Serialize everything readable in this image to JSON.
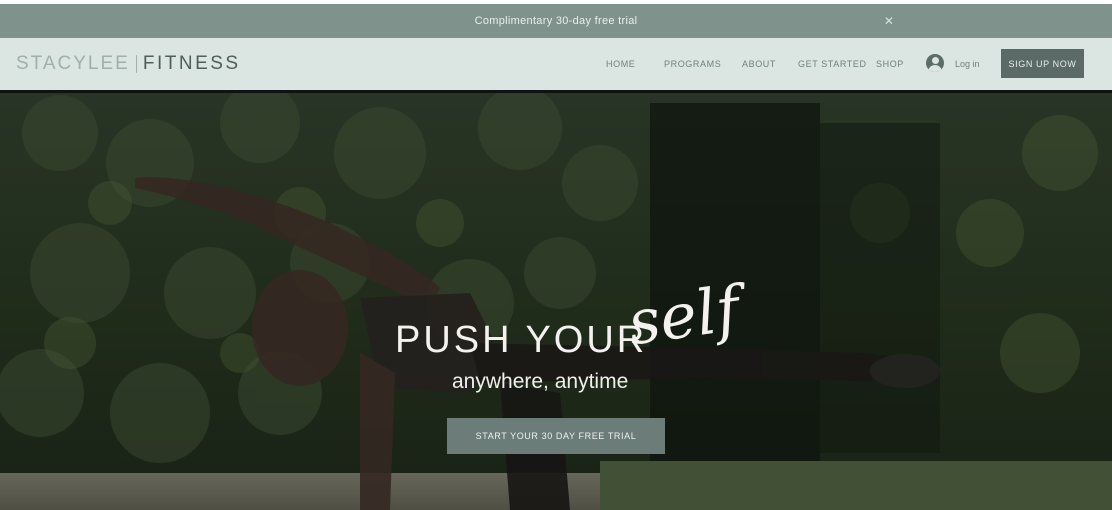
{
  "announcement": {
    "text": "Complimentary 30-day free trial",
    "close_icon": "close-icon"
  },
  "header": {
    "logo": {
      "name": "STACYLEE",
      "suffix": "FITNESS"
    },
    "nav": [
      {
        "label": "HOME"
      },
      {
        "label": "PROGRAMS"
      },
      {
        "label": "ABOUT"
      },
      {
        "label": "GET STARTED"
      },
      {
        "label": "SHOP"
      }
    ],
    "account_icon": "account-icon",
    "login_label": "Log in",
    "signup_label": "SIGN UP NOW"
  },
  "hero": {
    "title": "PUSH YOUR",
    "script": "self",
    "subtitle": "anywhere, anytime",
    "cta_label": "START YOUR 30 DAY FREE TRIAL"
  },
  "colors": {
    "announcement_bg": "#7f928b",
    "header_bg": "#dbe6e3",
    "button_bg": "#5b6a66",
    "cta_bg": "#6b7c79"
  }
}
